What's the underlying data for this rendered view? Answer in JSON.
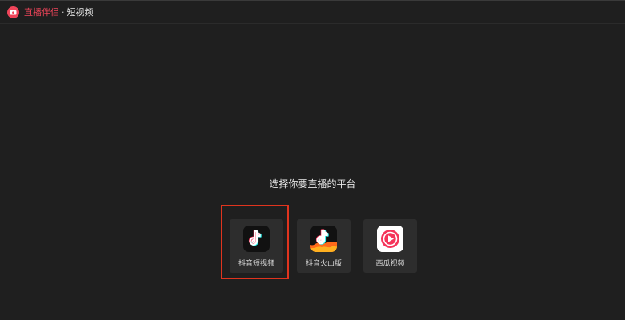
{
  "title_bar": {
    "app_name": "直播伴侣",
    "separator": "·",
    "mode": "短视频"
  },
  "main": {
    "prompt": "选择你要直播的平台",
    "platforms": [
      {
        "label": "抖音短视频",
        "icon": "douyin-icon",
        "selected": true
      },
      {
        "label": "抖音火山版",
        "icon": "douyin-huoshan-icon",
        "selected": false
      },
      {
        "label": "西瓜视频",
        "icon": "xigua-video-icon",
        "selected": false
      }
    ]
  },
  "colors": {
    "accent": "#f0455a",
    "selection": "#e0341e",
    "background": "#1f1f1f",
    "card": "#2d2d2d"
  }
}
